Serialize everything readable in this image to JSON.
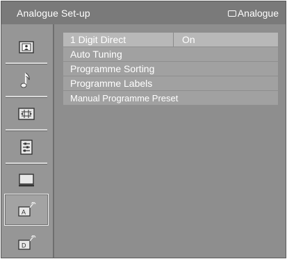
{
  "titlebar": {
    "title": "Analogue Set-up",
    "source_label": "Analogue"
  },
  "sidebar": {
    "items": [
      {
        "icon": "picture-icon",
        "selected": false
      },
      {
        "icon": "music-note-icon",
        "selected": false
      },
      {
        "icon": "screen-settings-icon",
        "selected": false
      },
      {
        "icon": "settings-list-icon",
        "selected": false
      },
      {
        "icon": "pc-monitor-icon",
        "selected": false
      },
      {
        "icon": "analogue-antenna-icon",
        "selected": true
      },
      {
        "icon": "digital-antenna-icon",
        "selected": false
      }
    ]
  },
  "menu": {
    "items": [
      {
        "label": "1 Digit Direct",
        "value": "On"
      },
      {
        "label": "Auto Tuning"
      },
      {
        "label": "Programme Sorting"
      },
      {
        "label": "Programme Labels"
      },
      {
        "label": "Manual Programme Preset"
      }
    ]
  },
  "colors": {
    "background": "#8e8e8e",
    "titlebar": "#7a7a7a",
    "text": "#ffffff",
    "highlight": "#b8b8b8"
  }
}
